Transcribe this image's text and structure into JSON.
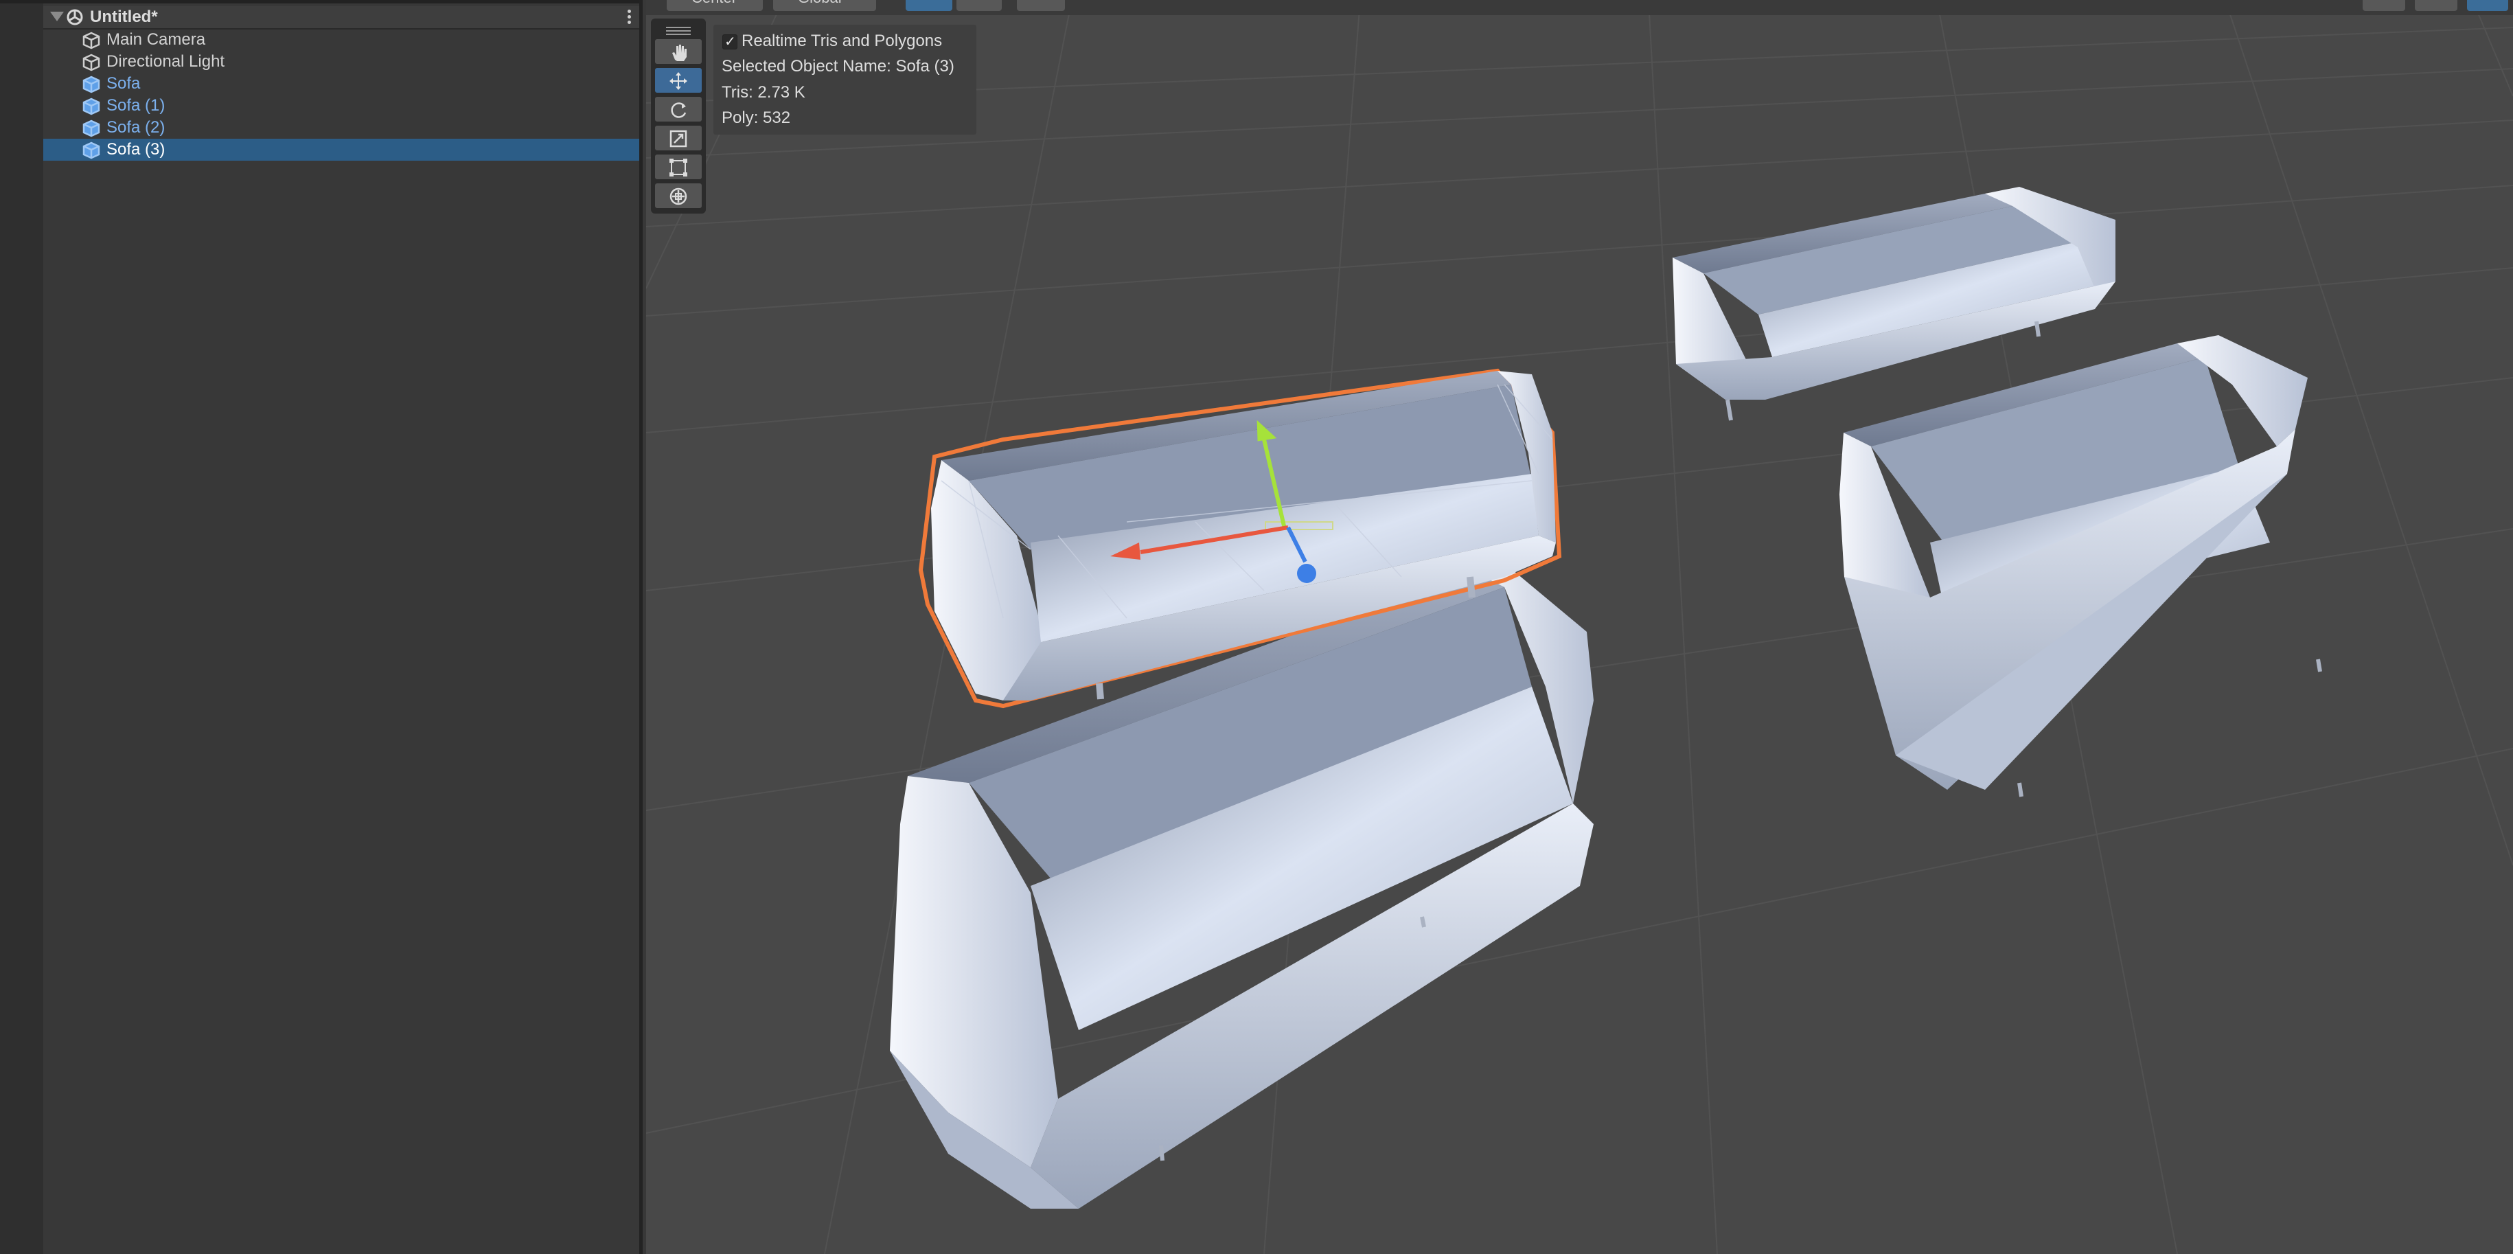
{
  "hierarchy": {
    "scene_title": "Untitled*",
    "items": [
      {
        "label": "Main Camera",
        "kind": "gameobject",
        "color": "#d2d2d2",
        "selected": false
      },
      {
        "label": "Directional Light",
        "kind": "gameobject",
        "color": "#d2d2d2",
        "selected": false
      },
      {
        "label": "Sofa",
        "kind": "prefab",
        "color": "#7cb1ef",
        "selected": false
      },
      {
        "label": "Sofa (1)",
        "kind": "prefab",
        "color": "#7cb1ef",
        "selected": false
      },
      {
        "label": "Sofa (2)",
        "kind": "prefab",
        "color": "#7cb1ef",
        "selected": false
      },
      {
        "label": "Sofa (3)",
        "kind": "prefab",
        "color": "#ffffff",
        "selected": true
      }
    ]
  },
  "scene_view": {
    "toolbar": {
      "pivot": "Center",
      "space": "Global"
    },
    "tools": [
      {
        "name": "hand-tool",
        "icon": "hand-icon",
        "active": false
      },
      {
        "name": "move-tool",
        "icon": "move-icon",
        "active": true
      },
      {
        "name": "rotate-tool",
        "icon": "rotate-icon",
        "active": false
      },
      {
        "name": "scale-tool",
        "icon": "scale-icon",
        "active": false
      },
      {
        "name": "rect-tool",
        "icon": "rect-icon",
        "active": false
      },
      {
        "name": "transform-tool",
        "icon": "transform-icon",
        "active": false
      }
    ],
    "stats_overlay": {
      "checkbox_label": "Realtime Tris and Polygons",
      "checked": true,
      "selected_object_line": "Selected Object Name: Sofa (3)",
      "tris_line": "Tris: 2.73 K",
      "poly_line": "Poly: 532"
    },
    "colors": {
      "selection_outline": "#f07a3a",
      "gizmo_x": "#e8573e",
      "gizmo_y": "#a6e23a",
      "gizmo_z": "#3d7fe6",
      "sofa": "#c9d3e6"
    }
  }
}
